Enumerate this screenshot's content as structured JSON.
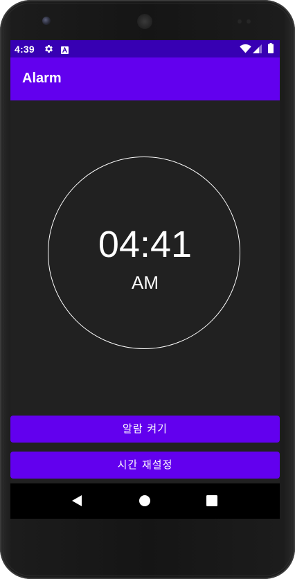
{
  "status_bar": {
    "time": "4:39",
    "icons": [
      "gear-icon",
      "a-badge-icon",
      "wifi-icon",
      "signal-icon",
      "battery-icon"
    ]
  },
  "app_bar": {
    "title": "Alarm"
  },
  "clock": {
    "time": "04:41",
    "period": "AM"
  },
  "buttons": {
    "alarm_on": "알람 켜기",
    "reset_time": "시간 재설정"
  },
  "nav_bar": {
    "icons": [
      "back-icon",
      "home-icon",
      "recents-icon"
    ]
  },
  "colors": {
    "status_bar": "#3700b3",
    "primary": "#6200ee",
    "background": "#212121",
    "text": "#ffffff"
  }
}
